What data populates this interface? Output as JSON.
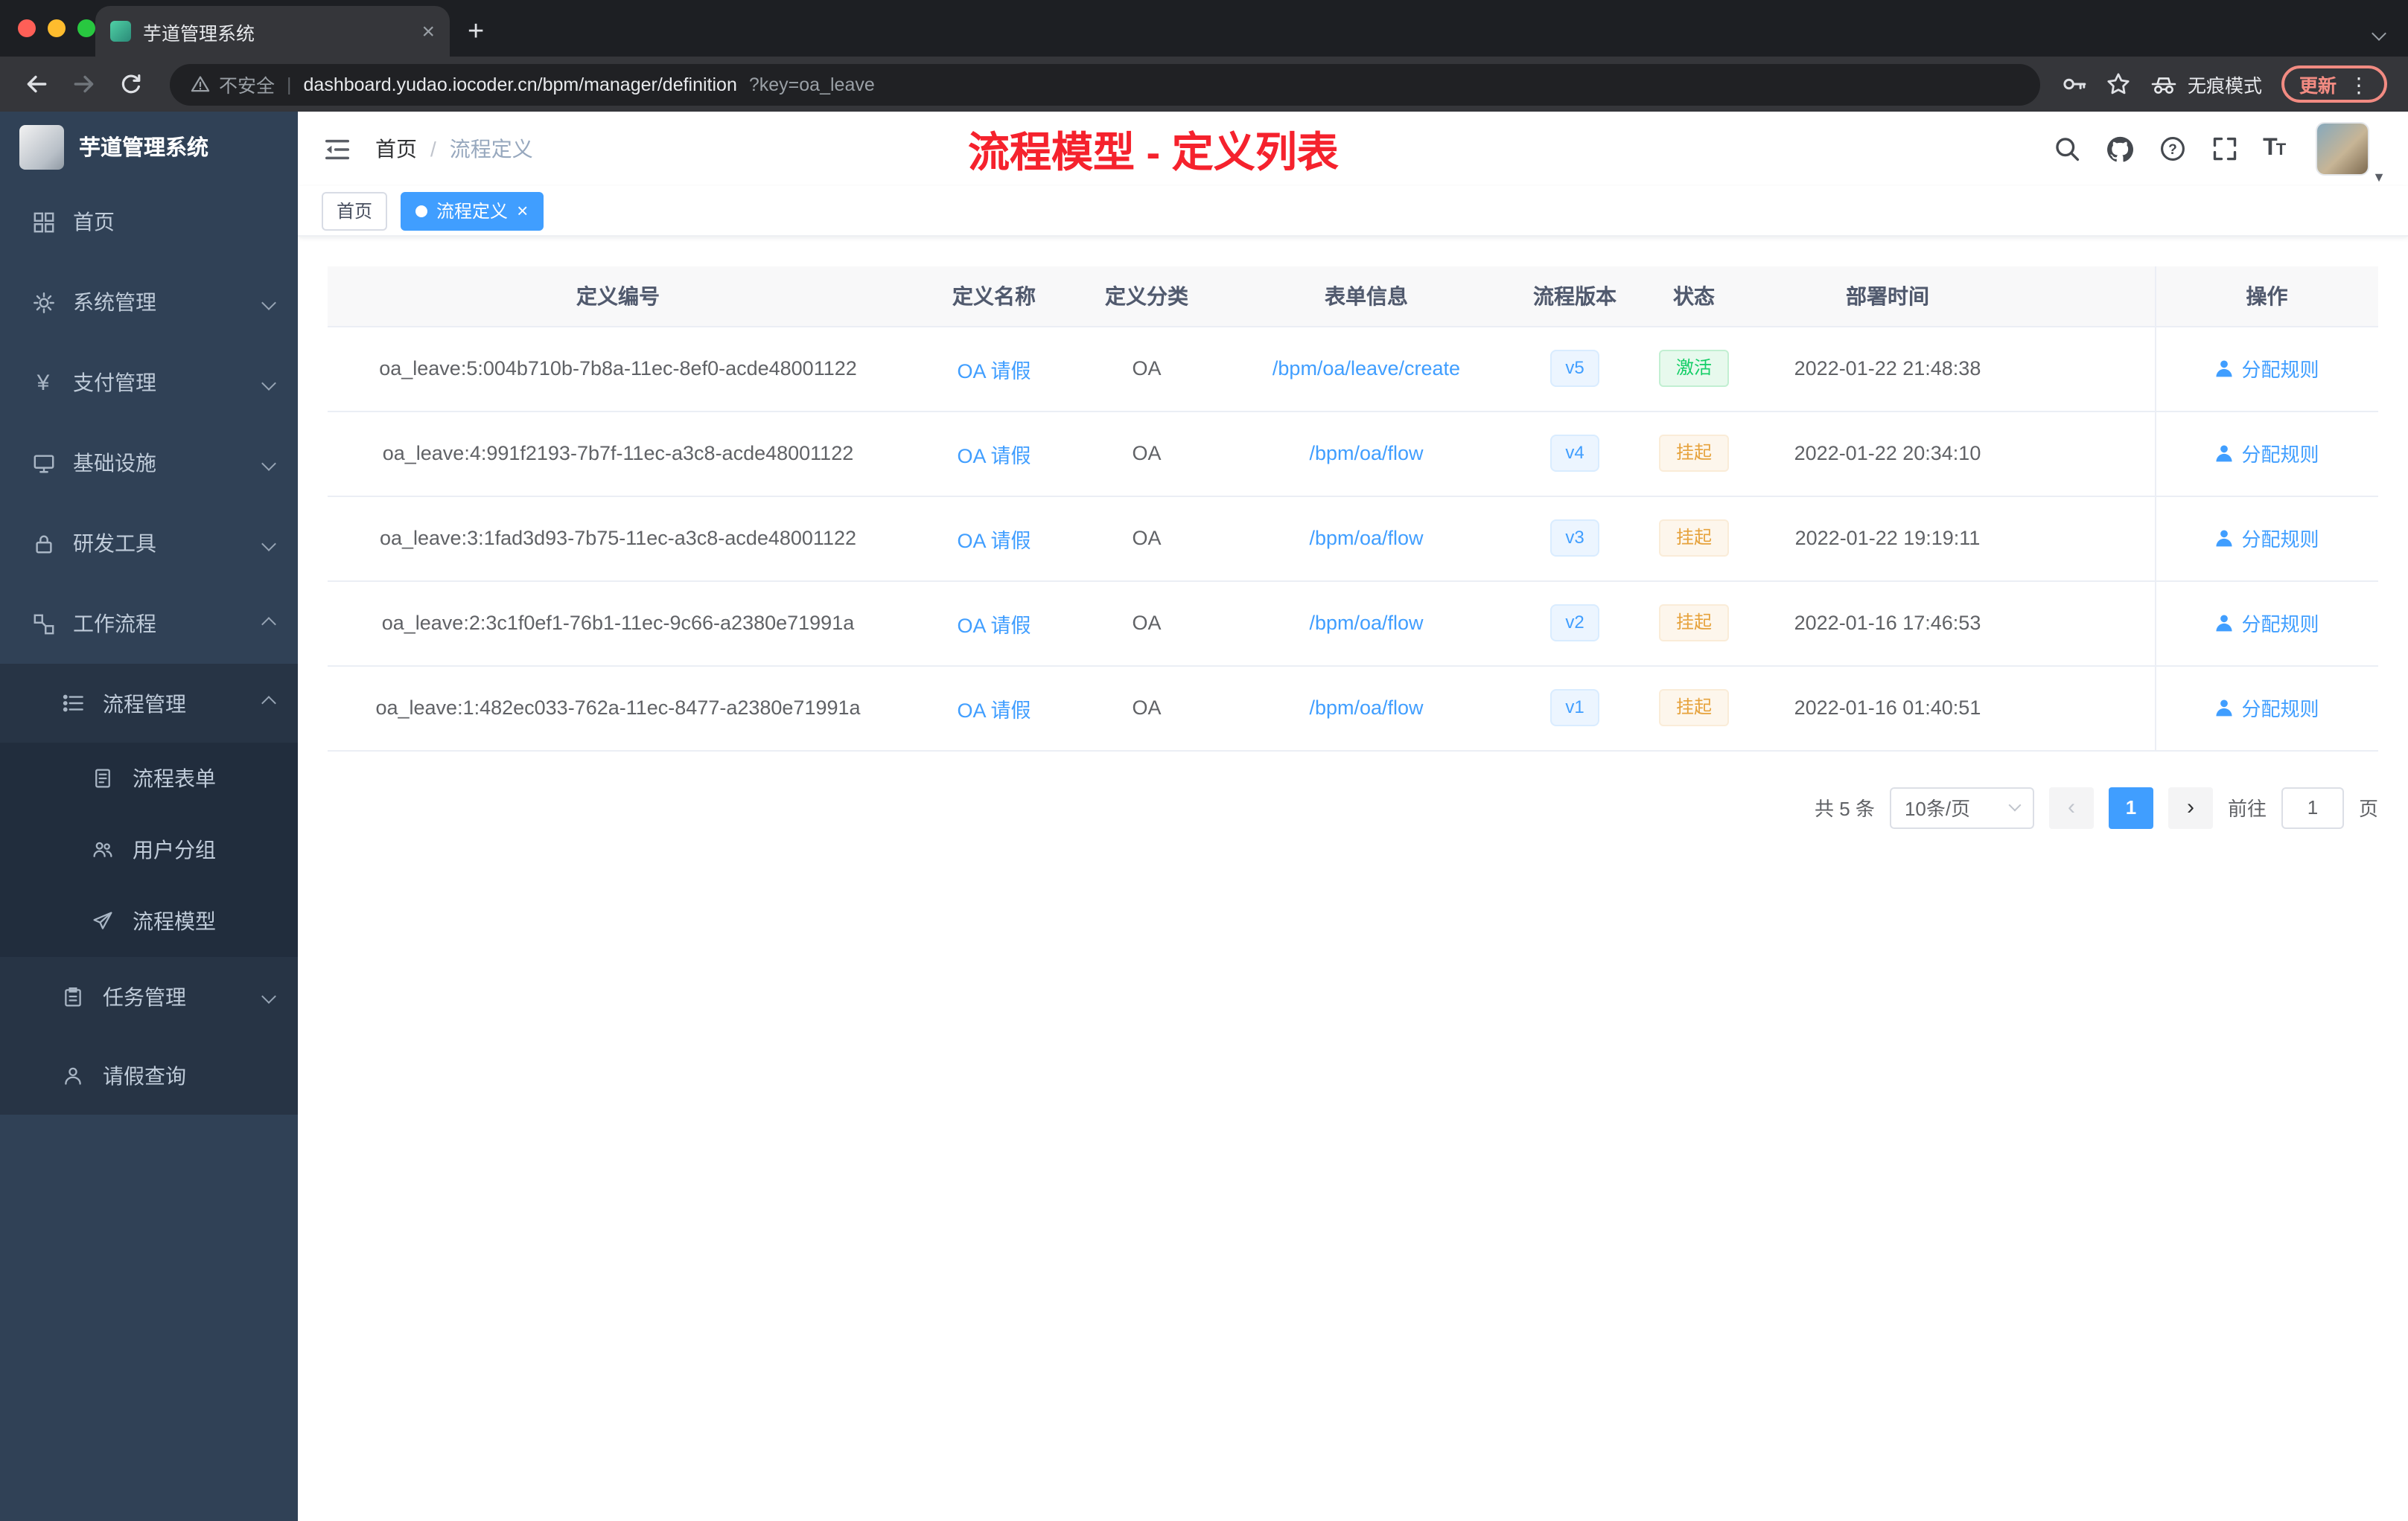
{
  "browser": {
    "tab_title": "芋道管理系统",
    "security_label": "不安全",
    "url_main": "dashboard.yudao.iocoder.cn/bpm/manager/definition",
    "url_query": "?key=oa_leave",
    "incognito_label": "无痕模式",
    "update_label": "更新"
  },
  "icons": {
    "close": "×",
    "new_tab": "+",
    "prev_page": "‹",
    "next_page": "›",
    "kebab": "⋮",
    "caret_down": "▼",
    "divider": "|",
    "yen": "¥"
  },
  "sidebar": {
    "logo_title": "芋道管理系统",
    "items": [
      {
        "label": "首页",
        "icon": "dashboard-icon"
      },
      {
        "label": "系统管理",
        "icon": "gear-icon"
      },
      {
        "label": "支付管理",
        "icon": "yen-icon"
      },
      {
        "label": "基础设施",
        "icon": "monitor-icon"
      },
      {
        "label": "研发工具",
        "icon": "lock-icon"
      },
      {
        "label": "工作流程",
        "icon": "workflow-icon"
      },
      {
        "label": "流程管理",
        "icon": "tree-list-icon"
      },
      {
        "label": "流程表单",
        "icon": "form-icon"
      },
      {
        "label": "用户分组",
        "icon": "user-group-icon"
      },
      {
        "label": "流程模型",
        "icon": "paper-plane-icon"
      },
      {
        "label": "任务管理",
        "icon": "clipboard-icon"
      },
      {
        "label": "请假查询",
        "icon": "person-icon"
      }
    ]
  },
  "header": {
    "breadcrumb_home": "首页",
    "breadcrumb_sep": "/",
    "breadcrumb_current": "流程定义",
    "annotation": "流程模型 - 定义列表"
  },
  "tags": {
    "home": "首页",
    "active": "流程定义"
  },
  "table": {
    "columns": [
      "定义编号",
      "定义名称",
      "定义分类",
      "表单信息",
      "流程版本",
      "状态",
      "部署时间",
      "操作"
    ],
    "rows": [
      {
        "id": "oa_leave:5:004b710b-7b8a-11ec-8ef0-acde48001122",
        "name": "OA 请假",
        "category": "OA",
        "form": "/bpm/oa/leave/create",
        "version": "v5",
        "status": "激活",
        "status_type": "success",
        "time": "2022-01-22 21:48:38",
        "action": "分配规则"
      },
      {
        "id": "oa_leave:4:991f2193-7b7f-11ec-a3c8-acde48001122",
        "name": "OA 请假",
        "category": "OA",
        "form": "/bpm/oa/flow",
        "version": "v4",
        "status": "挂起",
        "status_type": "warning",
        "time": "2022-01-22 20:34:10",
        "action": "分配规则"
      },
      {
        "id": "oa_leave:3:1fad3d93-7b75-11ec-a3c8-acde48001122",
        "name": "OA 请假",
        "category": "OA",
        "form": "/bpm/oa/flow",
        "version": "v3",
        "status": "挂起",
        "status_type": "warning",
        "time": "2022-01-22 19:19:11",
        "action": "分配规则"
      },
      {
        "id": "oa_leave:2:3c1f0ef1-76b1-11ec-9c66-a2380e71991a",
        "name": "OA 请假",
        "category": "OA",
        "form": "/bpm/oa/flow",
        "version": "v2",
        "status": "挂起",
        "status_type": "warning",
        "time": "2022-01-16 17:46:53",
        "action": "分配规则"
      },
      {
        "id": "oa_leave:1:482ec033-762a-11ec-8477-a2380e71991a",
        "name": "OA 请假",
        "category": "OA",
        "form": "/bpm/oa/flow",
        "version": "v1",
        "status": "挂起",
        "status_type": "warning",
        "time": "2022-01-16 01:40:51",
        "action": "分配规则"
      }
    ]
  },
  "pagination": {
    "total": "共 5 条",
    "page_size": "10条/页",
    "current_page": "1",
    "goto_label": "前往",
    "goto_value": "1",
    "goto_unit": "页"
  },
  "colors": {
    "accent": "#409eff",
    "annotation_red": "#f5222d",
    "success": "#13ce66",
    "warning": "#e6a23c",
    "sidebar_bg": "#304156"
  }
}
